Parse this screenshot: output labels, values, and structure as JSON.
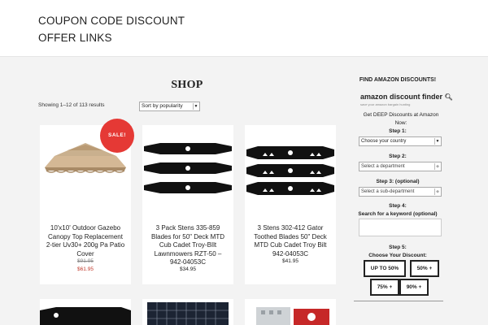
{
  "site": {
    "title_line1": "COUPON CODE DISCOUNT",
    "title_line2": "OFFER LINKS"
  },
  "shop": {
    "title": "SHOP",
    "result_count": "Showing 1–12 of 113 results",
    "orderby": "Sort by popularity"
  },
  "products": [
    {
      "title": "10'x10' Outdoor Gazebo Canopy Top Replacement 2-tier Uv30+ 200g Pa Patio Cover",
      "price_old": "$91.95",
      "price": "$61.95",
      "badge": "SALE!"
    },
    {
      "title": "3 Pack Stens 335-859 Blades for 50\" Deck MTD Cub Cadet Troy-BIlt Lawnmowers RZT-50 – 942-04053C",
      "price": "$34.95"
    },
    {
      "title": "3 Stens 302-412 Gator Toothed Blades 50\" Deck MTD Cub Cadet Troy Bilt 942-04053C",
      "price": "$41.95"
    }
  ],
  "sidebar": {
    "title": "FIND AMAZON DISCOUNTS!",
    "logo_text": "amazon discount finder",
    "logo_tagline": "save your amazon bargain hunting",
    "intro": "Get DEEP Discounts at Amazon Now:",
    "step1_label": "Step 1:",
    "step1_value": "Choose your country",
    "step2_label": "Step 2:",
    "step2_value": "Select a department",
    "step3_label": "Step 3: (optional)",
    "step3_value": "Select a sub-department",
    "step4_label": "Step 4:",
    "step4_sub": "Search for a keyword (optional)",
    "step5_label": "Step 5:",
    "step5_sub": "Choose Your Discount:",
    "discounts": [
      "UP TO 50%",
      "50% +",
      "75% +",
      "90% +"
    ]
  },
  "colors": {
    "sale_badge": "#e53935",
    "sale_price": "#c0392b",
    "background": "#f3f3f3"
  }
}
